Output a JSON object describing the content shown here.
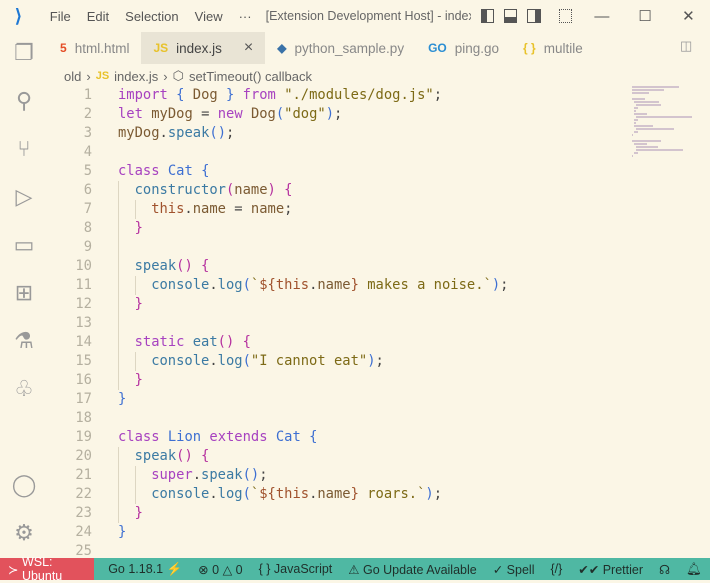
{
  "titlebar": {
    "menu": [
      "File",
      "Edit",
      "Selection",
      "View",
      "···"
    ],
    "title": "[Extension Development Host] - index.j..."
  },
  "tabs": [
    {
      "label": "html.html",
      "icon": "html5-icon",
      "icon_text": "5",
      "color": "#e44d26"
    },
    {
      "label": "index.js",
      "icon": "js-icon",
      "icon_text": "JS",
      "color": "#e8c22a",
      "active": true,
      "close": "×"
    },
    {
      "label": "python_sample.py",
      "icon": "python-icon",
      "icon_text": "◆",
      "color": "#3a72a8"
    },
    {
      "label": "ping.go",
      "icon": "go-icon",
      "icon_text": "GO",
      "color": "#2a8ed3"
    },
    {
      "label": "multile",
      "icon": "json-icon",
      "icon_text": "{ }",
      "color": "#e8c22a"
    }
  ],
  "breadcrumb": {
    "folder": "old",
    "file": "index.js",
    "file_icon": "JS",
    "symbol": "setTimeout() callback"
  },
  "code": [
    {
      "n": "1",
      "i": 0,
      "t": [
        [
          "kw",
          "import "
        ],
        [
          "br",
          "{ "
        ],
        [
          "id",
          "Dog "
        ],
        [
          "br",
          "} "
        ],
        [
          "kw",
          "from "
        ],
        [
          "str",
          "\"./modules/dog.js\""
        ],
        [
          "pn",
          ";"
        ]
      ]
    },
    {
      "n": "2",
      "i": 0,
      "t": [
        [
          "kw",
          "let "
        ],
        [
          "id",
          "myDog "
        ],
        [
          "pn",
          "= "
        ],
        [
          "kw",
          "new "
        ],
        [
          "id",
          "Dog"
        ],
        [
          "br",
          "("
        ],
        [
          "str",
          "\"dog\""
        ],
        [
          "br",
          ")"
        ],
        [
          "pn",
          ";"
        ]
      ]
    },
    {
      "n": "3",
      "i": 0,
      "t": [
        [
          "id",
          "myDog"
        ],
        [
          "pn",
          "."
        ],
        [
          "fn",
          "speak"
        ],
        [
          "br",
          "()"
        ],
        [
          "pn",
          ";"
        ]
      ]
    },
    {
      "n": "4",
      "i": 0,
      "t": []
    },
    {
      "n": "5",
      "i": 0,
      "t": [
        [
          "kw",
          "class "
        ],
        [
          "cls",
          "Cat "
        ],
        [
          "br",
          "{"
        ]
      ]
    },
    {
      "n": "6",
      "i": 1,
      "t": [
        [
          "fn",
          "constructor"
        ],
        [
          "br2",
          "("
        ],
        [
          "id",
          "name"
        ],
        [
          "br2",
          ")"
        ],
        [
          "pn",
          " "
        ],
        [
          "br2",
          "{"
        ]
      ]
    },
    {
      "n": "7",
      "i": 2,
      "t": [
        [
          "th",
          "this"
        ],
        [
          "pn",
          "."
        ],
        [
          "id",
          "name "
        ],
        [
          "pn",
          "= "
        ],
        [
          "id",
          "name"
        ],
        [
          "pn",
          ";"
        ]
      ]
    },
    {
      "n": "8",
      "i": 1,
      "t": [
        [
          "br2",
          "}"
        ]
      ]
    },
    {
      "n": "9",
      "i": 1,
      "t": []
    },
    {
      "n": "10",
      "i": 1,
      "t": [
        [
          "fn",
          "speak"
        ],
        [
          "br2",
          "() {"
        ]
      ]
    },
    {
      "n": "11",
      "i": 2,
      "t": [
        [
          "fn",
          "console"
        ],
        [
          "pn",
          "."
        ],
        [
          "fn",
          "log"
        ],
        [
          "br",
          "("
        ],
        [
          "str",
          "`"
        ],
        [
          "th",
          "${"
        ],
        [
          "th",
          "this"
        ],
        [
          "pn",
          "."
        ],
        [
          "id",
          "name"
        ],
        [
          "th",
          "}"
        ],
        [
          "str",
          " makes a noise.`"
        ],
        [
          "br",
          ")"
        ],
        [
          "pn",
          ";"
        ]
      ]
    },
    {
      "n": "12",
      "i": 1,
      "t": [
        [
          "br2",
          "}"
        ]
      ]
    },
    {
      "n": "13",
      "i": 1,
      "t": []
    },
    {
      "n": "14",
      "i": 1,
      "t": [
        [
          "kw",
          "static "
        ],
        [
          "fn",
          "eat"
        ],
        [
          "br2",
          "() {"
        ]
      ]
    },
    {
      "n": "15",
      "i": 2,
      "t": [
        [
          "fn",
          "console"
        ],
        [
          "pn",
          "."
        ],
        [
          "fn",
          "log"
        ],
        [
          "br",
          "("
        ],
        [
          "str",
          "\"I cannot eat\""
        ],
        [
          "br",
          ")"
        ],
        [
          "pn",
          ";"
        ]
      ]
    },
    {
      "n": "16",
      "i": 1,
      "t": [
        [
          "br2",
          "}"
        ]
      ]
    },
    {
      "n": "17",
      "i": 0,
      "t": [
        [
          "br",
          "}"
        ]
      ]
    },
    {
      "n": "18",
      "i": 0,
      "t": []
    },
    {
      "n": "19",
      "i": 0,
      "t": [
        [
          "kw",
          "class "
        ],
        [
          "cls",
          "Lion "
        ],
        [
          "kw",
          "extends "
        ],
        [
          "cls",
          "Cat "
        ],
        [
          "br",
          "{"
        ]
      ]
    },
    {
      "n": "20",
      "i": 1,
      "t": [
        [
          "fn",
          "speak"
        ],
        [
          "br2",
          "() {"
        ]
      ]
    },
    {
      "n": "21",
      "i": 2,
      "t": [
        [
          "kw",
          "super"
        ],
        [
          "pn",
          "."
        ],
        [
          "fn",
          "speak"
        ],
        [
          "br",
          "()"
        ],
        [
          "pn",
          ";"
        ]
      ]
    },
    {
      "n": "22",
      "i": 2,
      "t": [
        [
          "fn",
          "console"
        ],
        [
          "pn",
          "."
        ],
        [
          "fn",
          "log"
        ],
        [
          "br",
          "("
        ],
        [
          "str",
          "`"
        ],
        [
          "th",
          "${"
        ],
        [
          "th",
          "this"
        ],
        [
          "pn",
          "."
        ],
        [
          "id",
          "name"
        ],
        [
          "th",
          "}"
        ],
        [
          "str",
          " roars.`"
        ],
        [
          "br",
          ")"
        ],
        [
          "pn",
          ";"
        ]
      ]
    },
    {
      "n": "23",
      "i": 1,
      "t": [
        [
          "br2",
          "}"
        ]
      ]
    },
    {
      "n": "24",
      "i": 0,
      "t": [
        [
          "br",
          "}"
        ]
      ]
    },
    {
      "n": "25",
      "i": 0,
      "t": []
    }
  ],
  "status": {
    "remote": "WSL: Ubuntu",
    "go_version": "Go 1.18.1",
    "errors": "0",
    "warnings": "0",
    "language": "JavaScript",
    "go_update": "Go Update Available",
    "spell": "Spell",
    "prettier": "Prettier"
  },
  "colors": {
    "background": "#fbf6e6",
    "statusbar": "#4fb8a3",
    "remote": "#e2525c",
    "keyword": "#a742c0"
  }
}
